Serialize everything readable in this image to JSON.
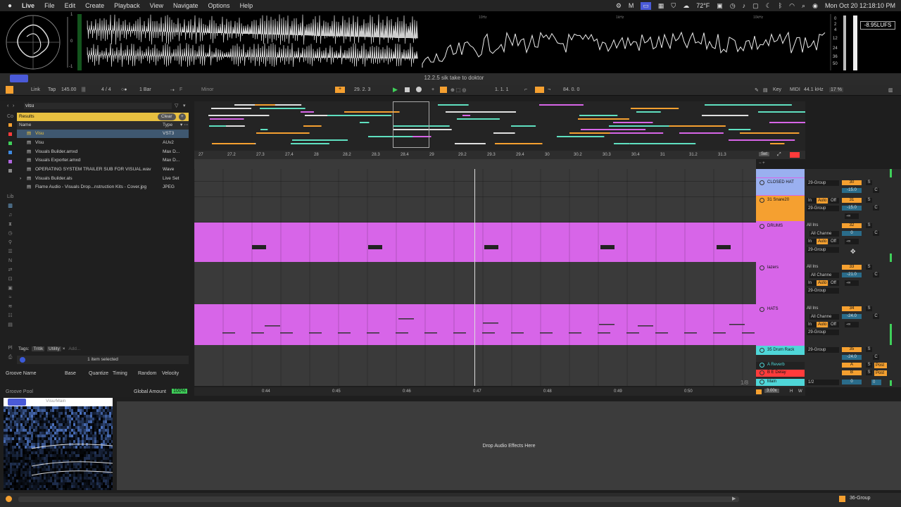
{
  "menubar": {
    "app": "Live",
    "items": [
      "File",
      "Edit",
      "Create",
      "Playback",
      "View",
      "Navigate",
      "Options",
      "Help"
    ],
    "weather": "72°F",
    "clock": "Mon Oct 20  12:18:10 PM"
  },
  "visualizer": {
    "scale_labels": [
      "1",
      "0",
      "-1"
    ],
    "freq_labels": [
      "10Hz",
      "1kHz",
      "10kHz"
    ],
    "meter_labels": [
      "0",
      "2",
      "4",
      "12",
      "24",
      "36",
      "50"
    ],
    "lufs": "-8.95LUFS"
  },
  "document_title": "12.2.5 sik take to doktor",
  "transport": {
    "link": "Link",
    "tap": "Tap",
    "tempo": "145.00",
    "signature": "4 / 4",
    "quantize": "1 Bar",
    "key": "F",
    "scale": "Minor",
    "position": "29.  2.  3",
    "loop_start": "1.  1.  1",
    "loop_length": "84.  0.  0",
    "key_label": "Key",
    "midi_label": "MIDI",
    "sample_rate": "44.1 kHz",
    "cpu": "17 %"
  },
  "browser": {
    "search": "visu",
    "results_label": "Results",
    "clear_label": "Clear",
    "col_name": "Name",
    "col_type": "Type",
    "items": [
      {
        "name": "Visu",
        "type": "VST3"
      },
      {
        "name": "Visu",
        "type": "AUv2"
      },
      {
        "name": "Visuals Builder.amxd",
        "type": "Max D..."
      },
      {
        "name": "Visuals Exporter.amxd",
        "type": "Max D..."
      },
      {
        "name": "OPERATING SYSTEM TRAILER SUB FOR VISUAL.wav",
        "type": "Wave"
      },
      {
        "name": "Visuals Builder.als",
        "type": "Live Set"
      },
      {
        "name": "Flame Audio - Visuals Drop...nstruction Kits - Cover.jpg",
        "type": "JPEG"
      }
    ],
    "tags_label": "Tags:",
    "tags": [
      "Tritik",
      "Utility",
      "Add..."
    ],
    "selected_count": "1 item selected"
  },
  "groove": {
    "columns": [
      "Groove Name",
      "Base",
      "Quantize",
      "Timing",
      "Random",
      "Velocity"
    ],
    "pool_label": "Groove Pool",
    "global_amount_label": "Global Amount",
    "global_amount": "100%"
  },
  "ruler": {
    "bars": [
      "27",
      "27.2",
      "27.3",
      "27.4",
      "28",
      "28.2",
      "28.3",
      "28.4",
      "29",
      "29.2",
      "29.3",
      "29.4",
      "30",
      "30.2",
      "30.3",
      "30.4",
      "31",
      "31.2",
      "31.3"
    ],
    "set_label": "Set"
  },
  "time_ruler": {
    "times": [
      "0:44",
      "0:45",
      "0:46",
      "0:47",
      "0:48",
      "0:49",
      "0:50"
    ],
    "zoom": "1/8"
  },
  "tracks": [
    {
      "name": "CLOSED HAT",
      "route": "29-Group",
      "number": "30",
      "volume": "-15.0",
      "pan": "C",
      "color": "#9ab0f0"
    },
    {
      "name": "31 Snare20",
      "input": "In",
      "auto": "Auto",
      "off": "Off",
      "route": "29-Group",
      "number": "31",
      "volume": "-15.0",
      "pan": "C",
      "sends": "-∞",
      "color": "#f5a030"
    },
    {
      "name": "DRUMS",
      "input": "All Ins",
      "channel": "All Channe",
      "in_label": "In",
      "auto": "Auto",
      "off": "Off",
      "route": "29-Group",
      "number": "32",
      "volume": "0",
      "pan": "C",
      "sends": "-∞",
      "color": "#d765e8"
    },
    {
      "name": "lazers",
      "input": "All Ins",
      "channel": "All Channe",
      "in_label": "In",
      "auto": "Auto",
      "off": "Off",
      "route": "29-Group",
      "number": "33",
      "volume": "-21.0",
      "pan": "C",
      "sends": "-∞",
      "color": "#d765e8"
    },
    {
      "name": "HATS",
      "input": "All Ins",
      "channel": "All Channe",
      "in_label": "In",
      "auto": "Auto",
      "off": "Off",
      "route": "29-Group",
      "number": "34",
      "volume": "-24.0",
      "pan": "C",
      "sends": "-∞",
      "color": "#d765e8"
    },
    {
      "name": "35 Drum Rack",
      "route": "29-Group",
      "number": "35",
      "volume": "-24.0",
      "pan": "C",
      "color": "#4fd6d8"
    }
  ],
  "returns": [
    {
      "name": "A Reverb",
      "letter": "A",
      "post": "Post",
      "color": "#4fd6d8"
    },
    {
      "name": "B E Delay",
      "letter": "B",
      "post": "Post",
      "color": "#ff3b3b"
    }
  ],
  "main": {
    "name": "Main",
    "route": "1/2",
    "volume": "0",
    "pan": "0",
    "color": "#4fd6d8"
  },
  "mixer_footer": {
    "zoom": "3.00x",
    "h": "H",
    "w": "W"
  },
  "device": {
    "drop_label": "Drop Audio Effects Here",
    "plugin_title": "Visu/Main"
  },
  "status": {
    "group_label": "36-Group"
  }
}
